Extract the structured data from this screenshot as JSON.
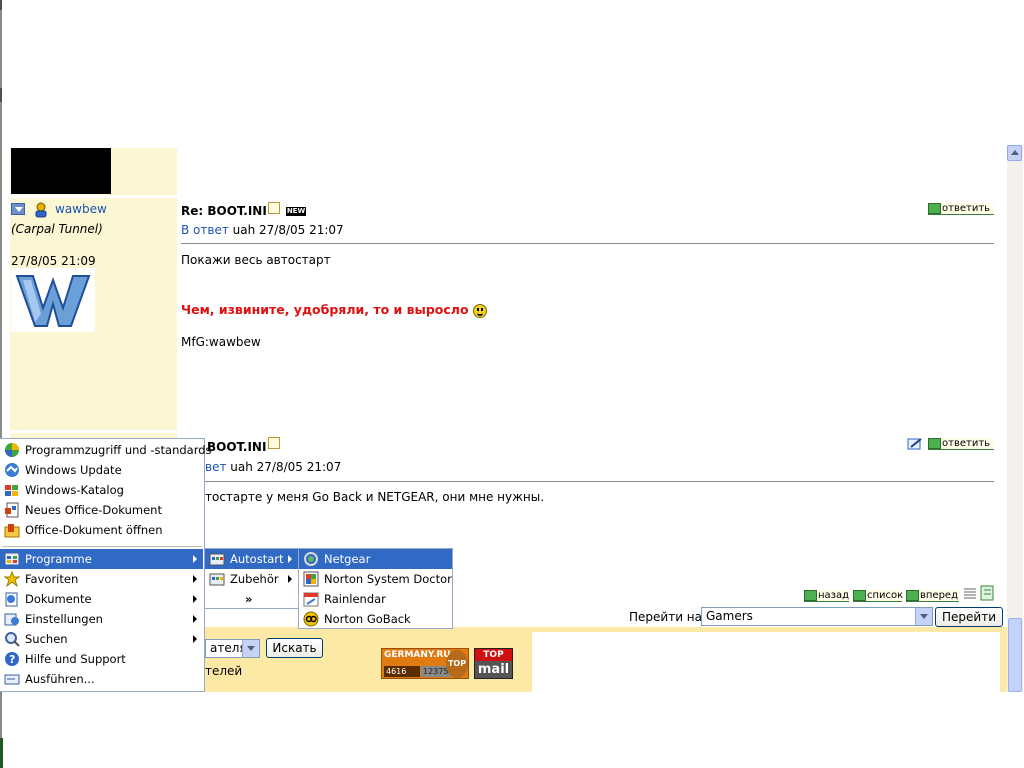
{
  "post1": {
    "author": "wawbew",
    "rank": "(Carpal Tunnel)",
    "date": "27/8/05 21:09",
    "avatar_letter": "W",
    "subject": "Re: BOOT.INI",
    "new_badge": "NEW",
    "reply_prefix": "В ответ",
    "reply_meta": "uah 27/8/05 21:07",
    "reply_button": "ответить",
    "line1": "Покажи весь автостарт",
    "line2": "Чем, извините, удобряли, то и выросло",
    "line3": "MfG:wawbew"
  },
  "post2": {
    "subject_partial": "BOOT.INI",
    "reply_prefix_partial": "вет",
    "reply_meta": "uah 27/8/05 21:07",
    "reply_button": "ответить",
    "line1_partial": "тостарте у меня Go Back и NETGEAR, они мне нужны."
  },
  "nav": {
    "back": "назад",
    "list": "список",
    "forward": "вперед"
  },
  "jump": {
    "label": "Перейти на",
    "selected": "Gamers",
    "button": "Перейти"
  },
  "search": {
    "select_partial": "ателя",
    "button": "Искать",
    "text_partial": "телей"
  },
  "counters": {
    "germany_title": "GERMANY.RU",
    "germany_num1": "4616",
    "germany_num2": "12375",
    "badge_top": "TOP",
    "topmail_top": "TOP",
    "topmail_bottom": "mail"
  },
  "start_menu": {
    "top_items": [
      {
        "label": "Programmzugriff und -standards",
        "icon": "program-access-icon"
      },
      {
        "label": "Windows Update",
        "icon": "windows-update-icon"
      },
      {
        "label": "Windows-Katalog",
        "icon": "windows-catalog-icon"
      },
      {
        "label": "Neues Office-Dokument",
        "icon": "new-office-document-icon"
      },
      {
        "label": "Office-Dokument öffnen",
        "icon": "open-office-document-icon"
      }
    ],
    "main_items": [
      {
        "label": "Programme",
        "icon": "programs-icon",
        "arrow": true,
        "selected": true
      },
      {
        "label": "Favoriten",
        "icon": "favorites-star-icon",
        "arrow": true
      },
      {
        "label": "Dokumente",
        "icon": "documents-icon",
        "arrow": true
      },
      {
        "label": "Einstellungen",
        "icon": "settings-icon",
        "arrow": true
      },
      {
        "label": "Suchen",
        "icon": "search-icon",
        "arrow": true
      },
      {
        "label": "Hilfe und Support",
        "icon": "help-icon",
        "arrow": false
      },
      {
        "label": "Ausführen...",
        "icon": "run-icon",
        "arrow": false
      }
    ],
    "programs_submenu": [
      {
        "label": "Autostart",
        "icon": "folder-icon",
        "selected": true
      },
      {
        "label": "Zubehör",
        "icon": "folder-icon",
        "selected": false
      },
      {
        "label": "»",
        "icon": "expand-chevron-icon",
        "selected": false
      }
    ],
    "autostart_submenu": [
      {
        "label": "Netgear",
        "icon": "netgear-icon",
        "selected": true
      },
      {
        "label": "Norton System Doctor",
        "icon": "norton-system-doctor-icon",
        "selected": false
      },
      {
        "label": "Rainlendar",
        "icon": "rainlendar-icon",
        "selected": false
      },
      {
        "label": "Norton GoBack",
        "icon": "norton-goback-icon",
        "selected": false
      }
    ]
  },
  "colors": {
    "menu_highlight": "#316ac5",
    "author_bg": "#fbf6d4",
    "link": "#1c55b0",
    "red_text": "#e01010"
  }
}
